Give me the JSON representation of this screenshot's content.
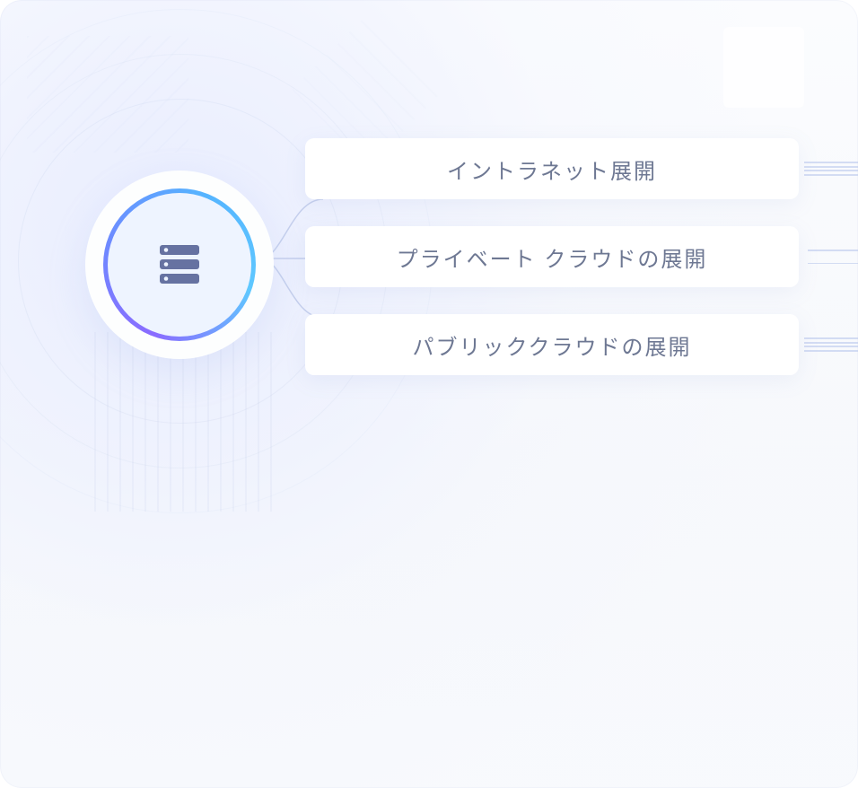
{
  "hub": {
    "icon_name": "server-icon"
  },
  "options": [
    {
      "label": "イントラネット展開"
    },
    {
      "label": "プライベート クラウドの展開"
    },
    {
      "label": "パブリッククラウドの展開"
    }
  ],
  "colors": {
    "gradient_start": "#8a6bff",
    "gradient_mid": "#5aa9ff",
    "gradient_end": "#5fc8ff",
    "text": "#6e7893",
    "icon": "#6672a1"
  }
}
